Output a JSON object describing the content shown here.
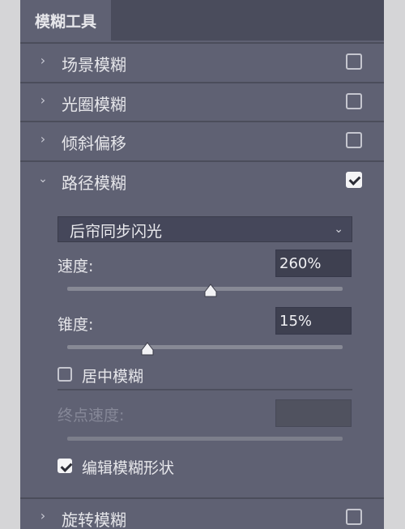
{
  "panel": {
    "tab_title": "模糊工具"
  },
  "sections": [
    {
      "label": "场景模糊",
      "expanded": false,
      "checked": false
    },
    {
      "label": "光圈模糊",
      "expanded": false,
      "checked": false
    },
    {
      "label": "倾斜偏移",
      "expanded": false,
      "checked": false
    },
    {
      "label": "路径模糊",
      "expanded": true,
      "checked": true
    },
    {
      "label": "旋转模糊",
      "expanded": false,
      "checked": false
    }
  ],
  "path_blur": {
    "preset_value": "后帘同步闪光",
    "speed": {
      "label": "速度:",
      "value": "260%",
      "slider_fraction": 0.52
    },
    "taper": {
      "label": "锥度:",
      "value": "15%",
      "slider_fraction": 0.29
    },
    "centered_blur": {
      "label": "居中模糊",
      "checked": false
    },
    "end_speed": {
      "label": "终点速度:",
      "value": "",
      "disabled": true
    },
    "edit_blur_shapes": {
      "label": "编辑模糊形状",
      "checked": true
    }
  },
  "icons": {
    "collapsed": "chevron-right-icon",
    "expanded": "chevron-down-icon",
    "dropdown": "chevron-down-icon",
    "slider_handle": "triangle-handle-icon"
  },
  "colors": {
    "panel_bg": "#5f6173",
    "tab_bar_bg": "#4a4c5c",
    "input_bg": "#3e4050",
    "text": "#e6e6ea"
  }
}
